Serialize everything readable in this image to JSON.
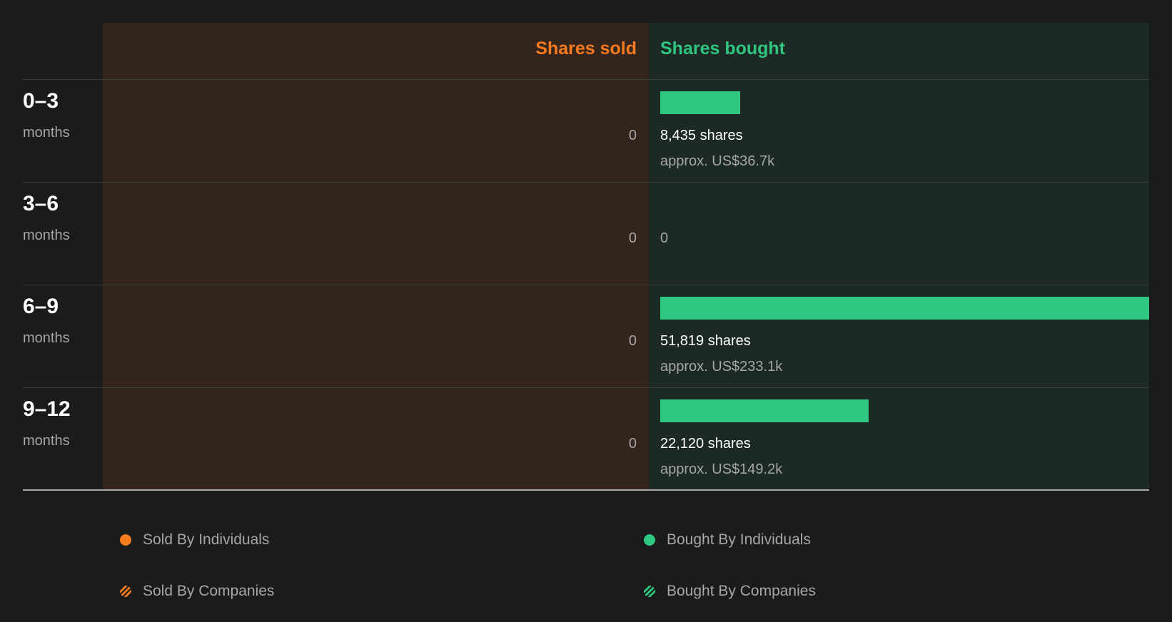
{
  "colors": {
    "sold": "#f97a1f",
    "bought": "#2fc780",
    "sold_bg": "#33241c",
    "bought_bg": "#1c2924"
  },
  "headers": {
    "sold": "Shares sold",
    "bought": "Shares bought"
  },
  "rows": [
    {
      "range": "0–3",
      "unit": "months",
      "sold": "0",
      "bought_shares": "8,435 shares",
      "bought_approx": "approx. US$36.7k",
      "bought_value": 8435
    },
    {
      "range": "3–6",
      "unit": "months",
      "sold": "0",
      "bought_zero": "0",
      "bought_value": 0
    },
    {
      "range": "6–9",
      "unit": "months",
      "sold": "0",
      "bought_shares": "51,819 shares",
      "bought_approx": "approx. US$233.1k",
      "bought_value": 51819
    },
    {
      "range": "9–12",
      "unit": "months",
      "sold": "0",
      "bought_shares": "22,120 shares",
      "bought_approx": "approx. US$149.2k",
      "bought_value": 22120
    }
  ],
  "legend": {
    "sold_individuals": "Sold By Individuals",
    "sold_companies": "Sold By Companies",
    "bought_individuals": "Bought By Individuals",
    "bought_companies": "Bought By Companies"
  },
  "chart_data": {
    "type": "bar",
    "categories": [
      "0–3",
      "3–6",
      "6–9",
      "9–12"
    ],
    "category_unit": "months",
    "series": [
      {
        "name": "Shares sold",
        "values": [
          0,
          0,
          0,
          0
        ]
      },
      {
        "name": "Shares bought",
        "values": [
          8435,
          0,
          51819,
          22120
        ]
      }
    ],
    "value_labels": [
      "approx. US$36.7k",
      "",
      "approx. US$233.1k",
      "approx. US$149.2k"
    ],
    "legend": [
      "Sold By Individuals",
      "Sold By Companies",
      "Bought By Individuals",
      "Bought By Companies"
    ],
    "legend_position": "bottom"
  }
}
